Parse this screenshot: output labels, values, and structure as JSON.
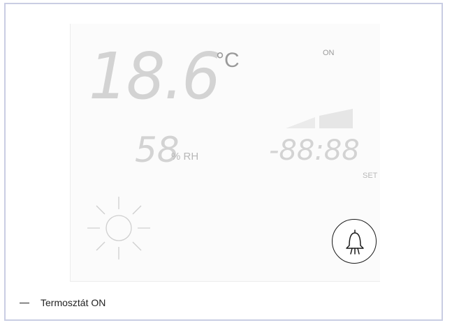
{
  "display": {
    "temperature": "18.6",
    "temperature_unit": "°C",
    "on_indicator": "ON",
    "humidity": "58",
    "humidity_unit": "% RH",
    "clock": "-88:88",
    "set_label": "SET"
  },
  "icons": {
    "weather": "sun-icon",
    "signal": "signal-strength-icon",
    "alarm": "bell-icon"
  },
  "caption": {
    "text": "Termosztát ON"
  },
  "colors": {
    "segment_inactive": "#d3d3d3",
    "frame_border": "#c9cde3",
    "icon_stroke": "#1a1a1a"
  }
}
